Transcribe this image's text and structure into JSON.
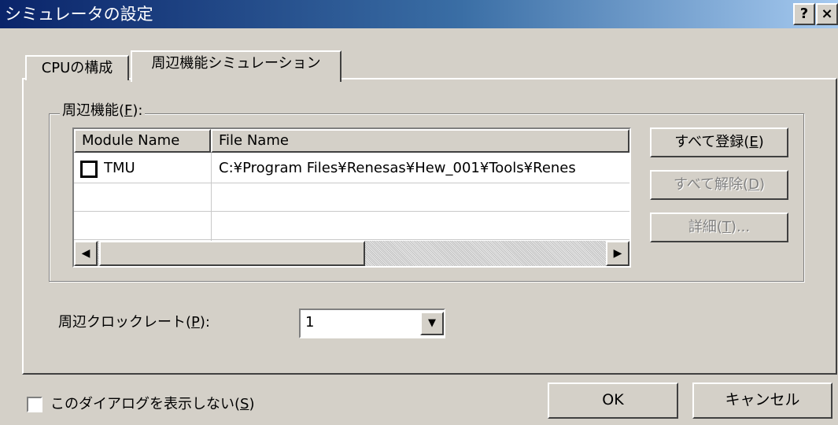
{
  "window": {
    "title": "シミュレータの設定",
    "help_glyph": "?",
    "close_glyph": "×"
  },
  "tabs": [
    {
      "label": "CPUの構成",
      "selected": false
    },
    {
      "label": "周辺機能シミュレーション",
      "selected": true
    }
  ],
  "peripheral_group": {
    "label_pre": "周辺機能(",
    "label_key": "F",
    "label_post": "):",
    "columns": [
      "Module Name",
      "File Name"
    ],
    "rows": [
      {
        "checked": false,
        "module": "TMU",
        "file": "C:¥Program Files¥Renesas¥Hew_001¥Tools¥Renes"
      }
    ]
  },
  "side_buttons": [
    {
      "pre": "すべて登録(",
      "key": "E",
      "post": ")",
      "enabled": true
    },
    {
      "pre": "すべて解除(",
      "key": "D",
      "post": ")",
      "enabled": false
    },
    {
      "pre": "詳細(",
      "key": "T",
      "post": ")...",
      "enabled": false
    }
  ],
  "clock_rate": {
    "label_pre": "周辺クロックレート(",
    "label_key": "P",
    "label_post": "):",
    "value": "1"
  },
  "footer": {
    "dont_show_pre": "このダイアログを表示しない(",
    "dont_show_key": "S",
    "dont_show_post": ")",
    "dont_show_checked": false,
    "ok_label": "OK",
    "cancel_label": "キャンセル"
  },
  "colors": {
    "title_start": "#0a246a",
    "title_end": "#a6caf0",
    "face": "#d4d0c8"
  }
}
